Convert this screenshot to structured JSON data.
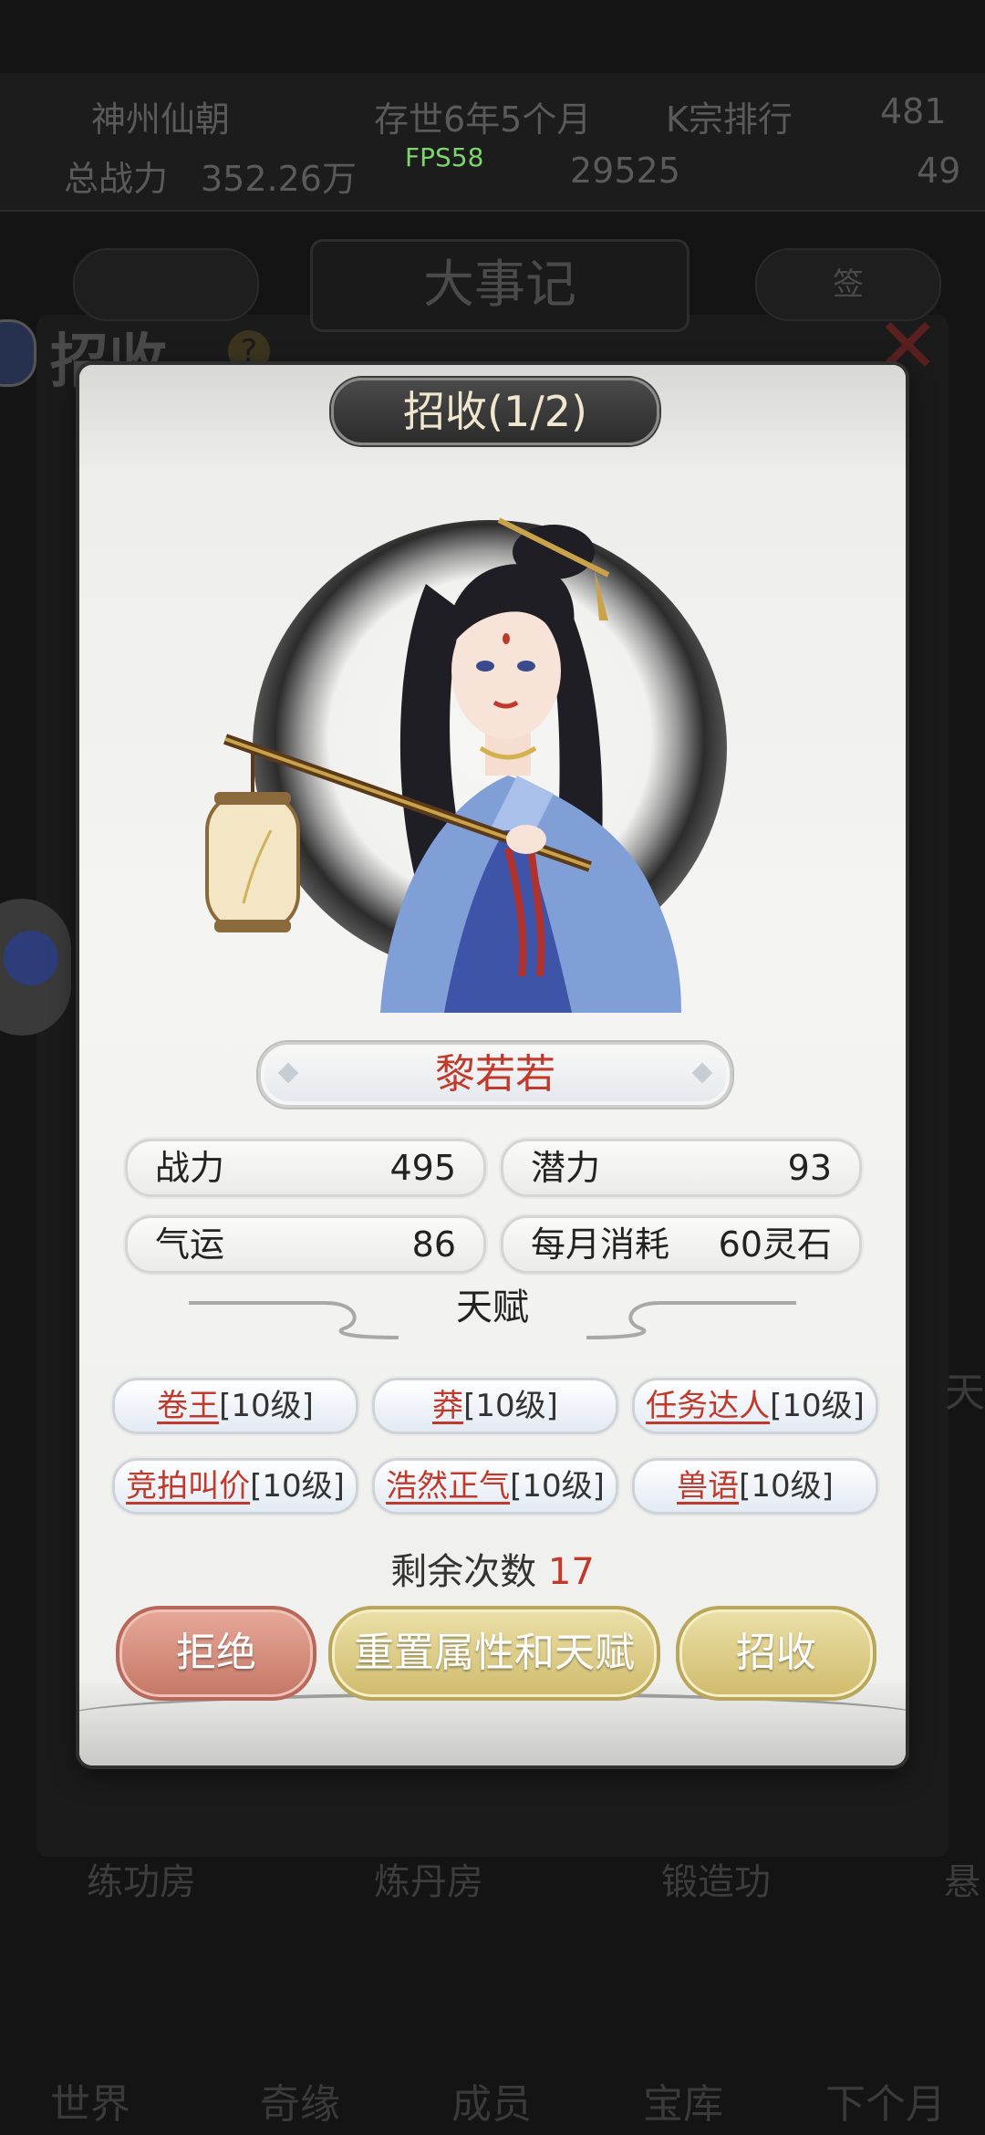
{
  "background": {
    "top_row1": [
      "神州仙朝",
      "存世6年5个月",
      "K宗排行",
      "481"
    ],
    "top_row2": [
      "总战力",
      "352.26万",
      "",
      "29525",
      "",
      "49"
    ],
    "fps": "FPS58",
    "title": "大事记",
    "side_left_btn": "",
    "side_right_btn": "签",
    "heading": "招收",
    "help_icon": "?",
    "bottom_buildings": [
      "练功房",
      "炼丹房",
      "锻造功",
      "悬"
    ],
    "nav": [
      "世界",
      "奇缘",
      "成员",
      "宝库",
      "下个月"
    ],
    "right_edge": "天"
  },
  "dialog": {
    "title": "招收(1/2)",
    "name": "黎若若",
    "stats": [
      {
        "label": "战力",
        "value": "495"
      },
      {
        "label": "潜力",
        "value": "93"
      },
      {
        "label": "气运",
        "value": "86"
      },
      {
        "label": "每月消耗",
        "value": "60灵石"
      }
    ],
    "talent_heading": "天赋",
    "talents": [
      {
        "name": "卷王",
        "level": "[10级]"
      },
      {
        "name": "莽",
        "level": "[10级]"
      },
      {
        "name": "任务达人",
        "level": "[10级]"
      },
      {
        "name": "竞拍叫价",
        "level": "[10级]"
      },
      {
        "name": "浩然正气",
        "level": "[10级]"
      },
      {
        "name": "兽语",
        "level": "[10级]"
      }
    ],
    "remaining_label": "剩余次数",
    "remaining_count": "17",
    "buttons": {
      "reject": "拒绝",
      "reset": "重置属性和天赋",
      "accept": "招收"
    }
  },
  "colors": {
    "accent_red": "#c0392b",
    "gold_button": "#d8c77f",
    "reject_button": "#d48a79"
  }
}
